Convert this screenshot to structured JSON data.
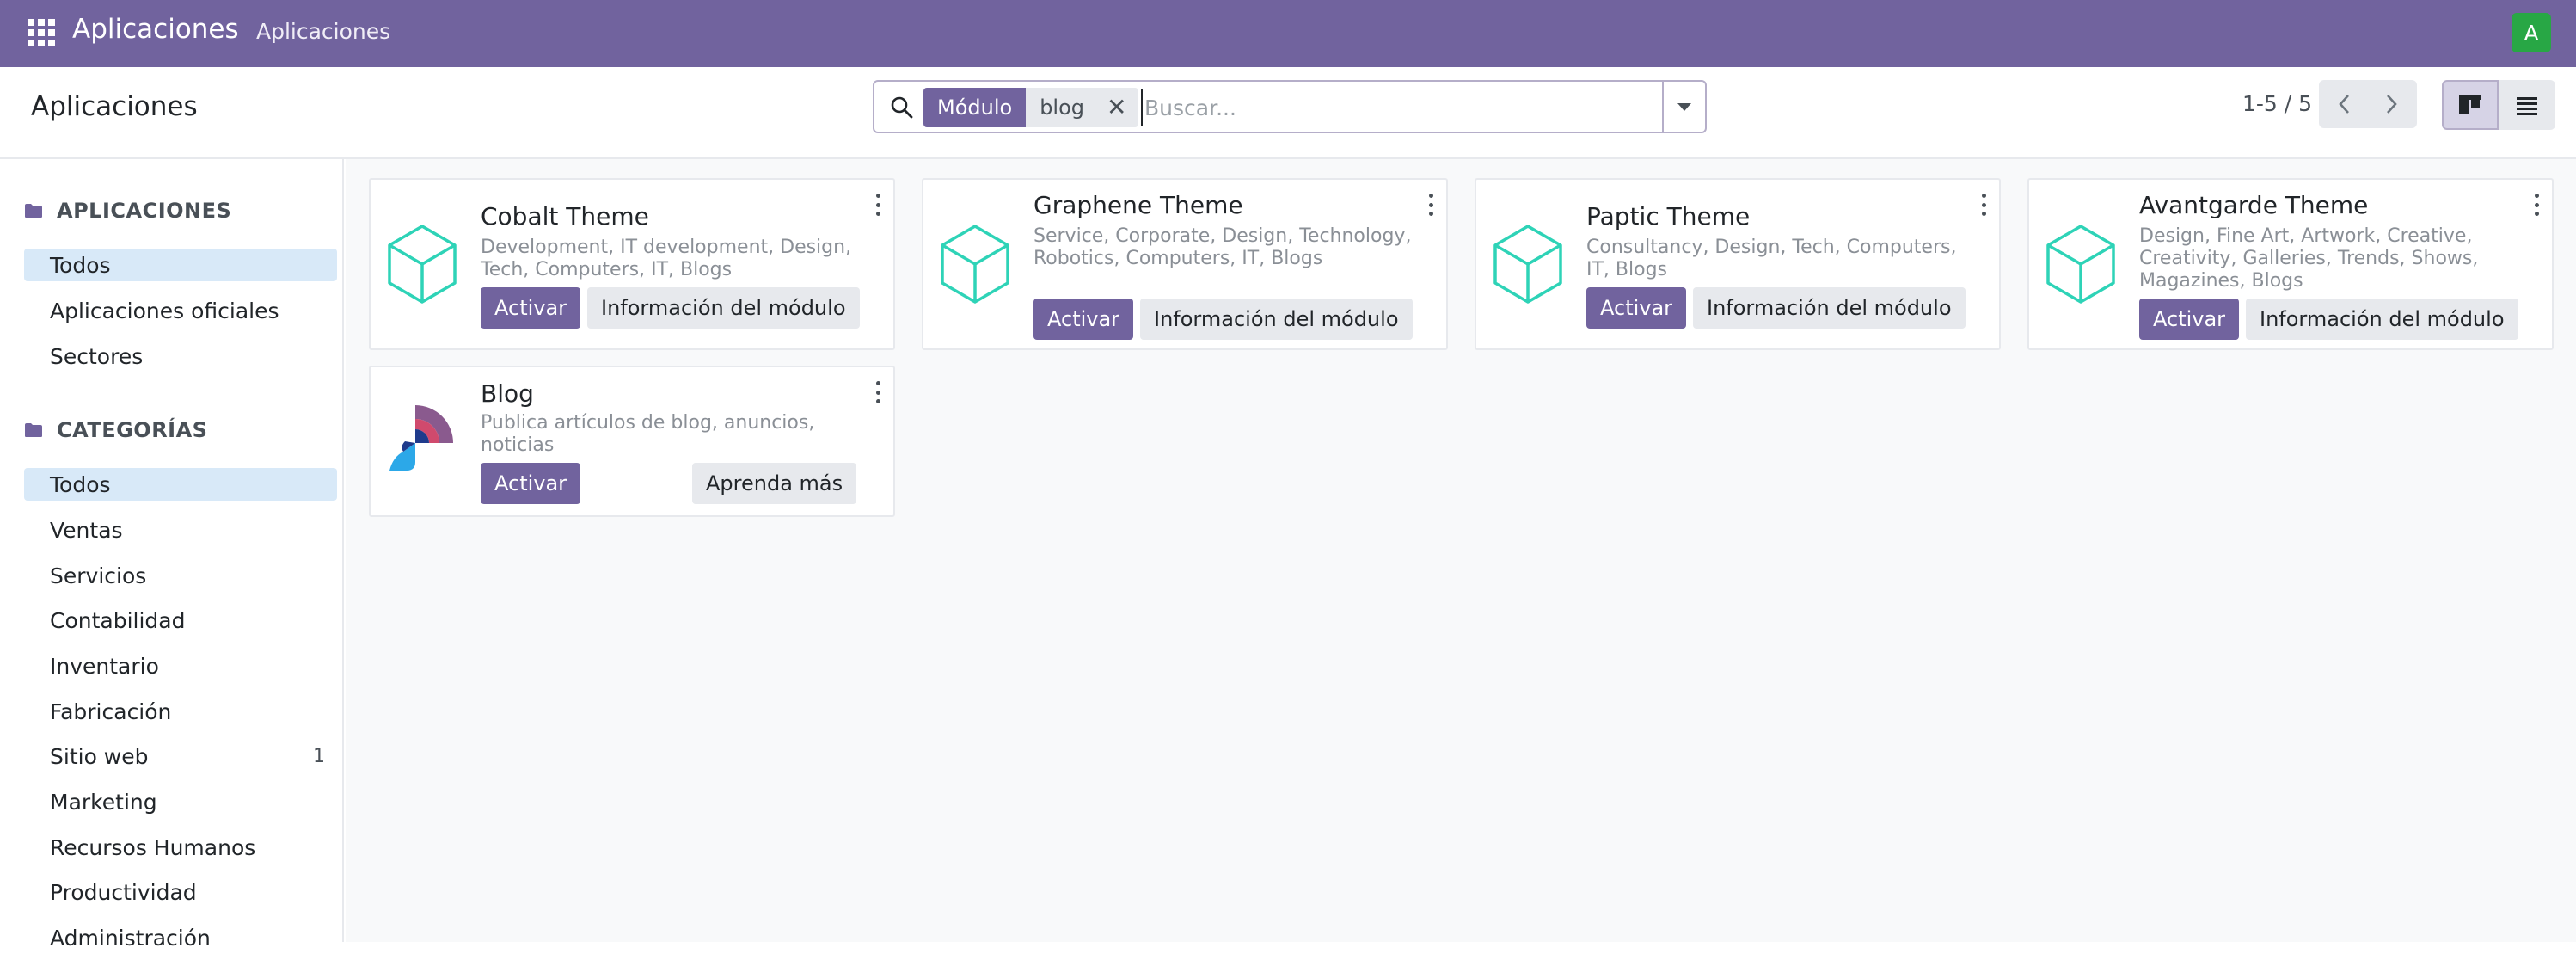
{
  "navbar": {
    "app_name": "Aplicaciones",
    "menu_item": "Aplicaciones",
    "avatar_letter": "A",
    "color": "#71639e"
  },
  "control_panel": {
    "title": "Aplicaciones",
    "search": {
      "facet_label": "Módulo",
      "facet_value": "blog",
      "facet_close": "✕",
      "placeholder": "Buscar..."
    },
    "pager": {
      "value": "1-5 / 5"
    }
  },
  "sidebar": {
    "sections": [
      {
        "title": "APLICACIONES",
        "items": [
          {
            "label": "Todos",
            "active": true
          },
          {
            "label": "Aplicaciones oficiales"
          },
          {
            "label": "Sectores"
          }
        ]
      },
      {
        "title": "CATEGORÍAS",
        "items": [
          {
            "label": "Todos",
            "active": true
          },
          {
            "label": "Ventas"
          },
          {
            "label": "Servicios"
          },
          {
            "label": "Contabilidad"
          },
          {
            "label": "Inventario"
          },
          {
            "label": "Fabricación"
          },
          {
            "label": "Sitio web",
            "count": "1"
          },
          {
            "label": "Marketing"
          },
          {
            "label": "Recursos Humanos"
          },
          {
            "label": "Productividad"
          },
          {
            "label": "Administración"
          }
        ]
      }
    ]
  },
  "modules": [
    {
      "title": "Cobalt Theme",
      "summary": "Development, IT development, Design, Tech, Computers, IT, Blogs",
      "primary": "Activar",
      "secondary": "Información del módulo",
      "icon": "theme-cube-icon"
    },
    {
      "title": "Graphene Theme",
      "summary": "Service, Corporate, Design, Technology, Robotics, Computers, IT, Blogs",
      "primary": "Activar",
      "secondary": "Información del módulo",
      "icon": "theme-cube-icon"
    },
    {
      "title": "Paptic Theme",
      "summary": "Consultancy, Design, Tech, Computers, IT, Blogs",
      "primary": "Activar",
      "secondary": "Información del módulo",
      "icon": "theme-cube-icon"
    },
    {
      "title": "Avantgarde Theme",
      "summary": "Design, Fine Art, Artwork, Creative, Creativity, Galleries, Trends, Shows, Magazines, Blogs",
      "primary": "Activar",
      "secondary": "Información del módulo",
      "icon": "theme-cube-icon"
    },
    {
      "title": "Blog",
      "summary": "Publica artículos de blog, anuncios, noticias",
      "primary": "Activar",
      "secondary": "Aprenda más",
      "icon": "blog-app-icon"
    }
  ],
  "colors": {
    "accent": "#71639e",
    "theme_icon": "#2ed3b7",
    "active_bg": "#d8e9f8"
  }
}
